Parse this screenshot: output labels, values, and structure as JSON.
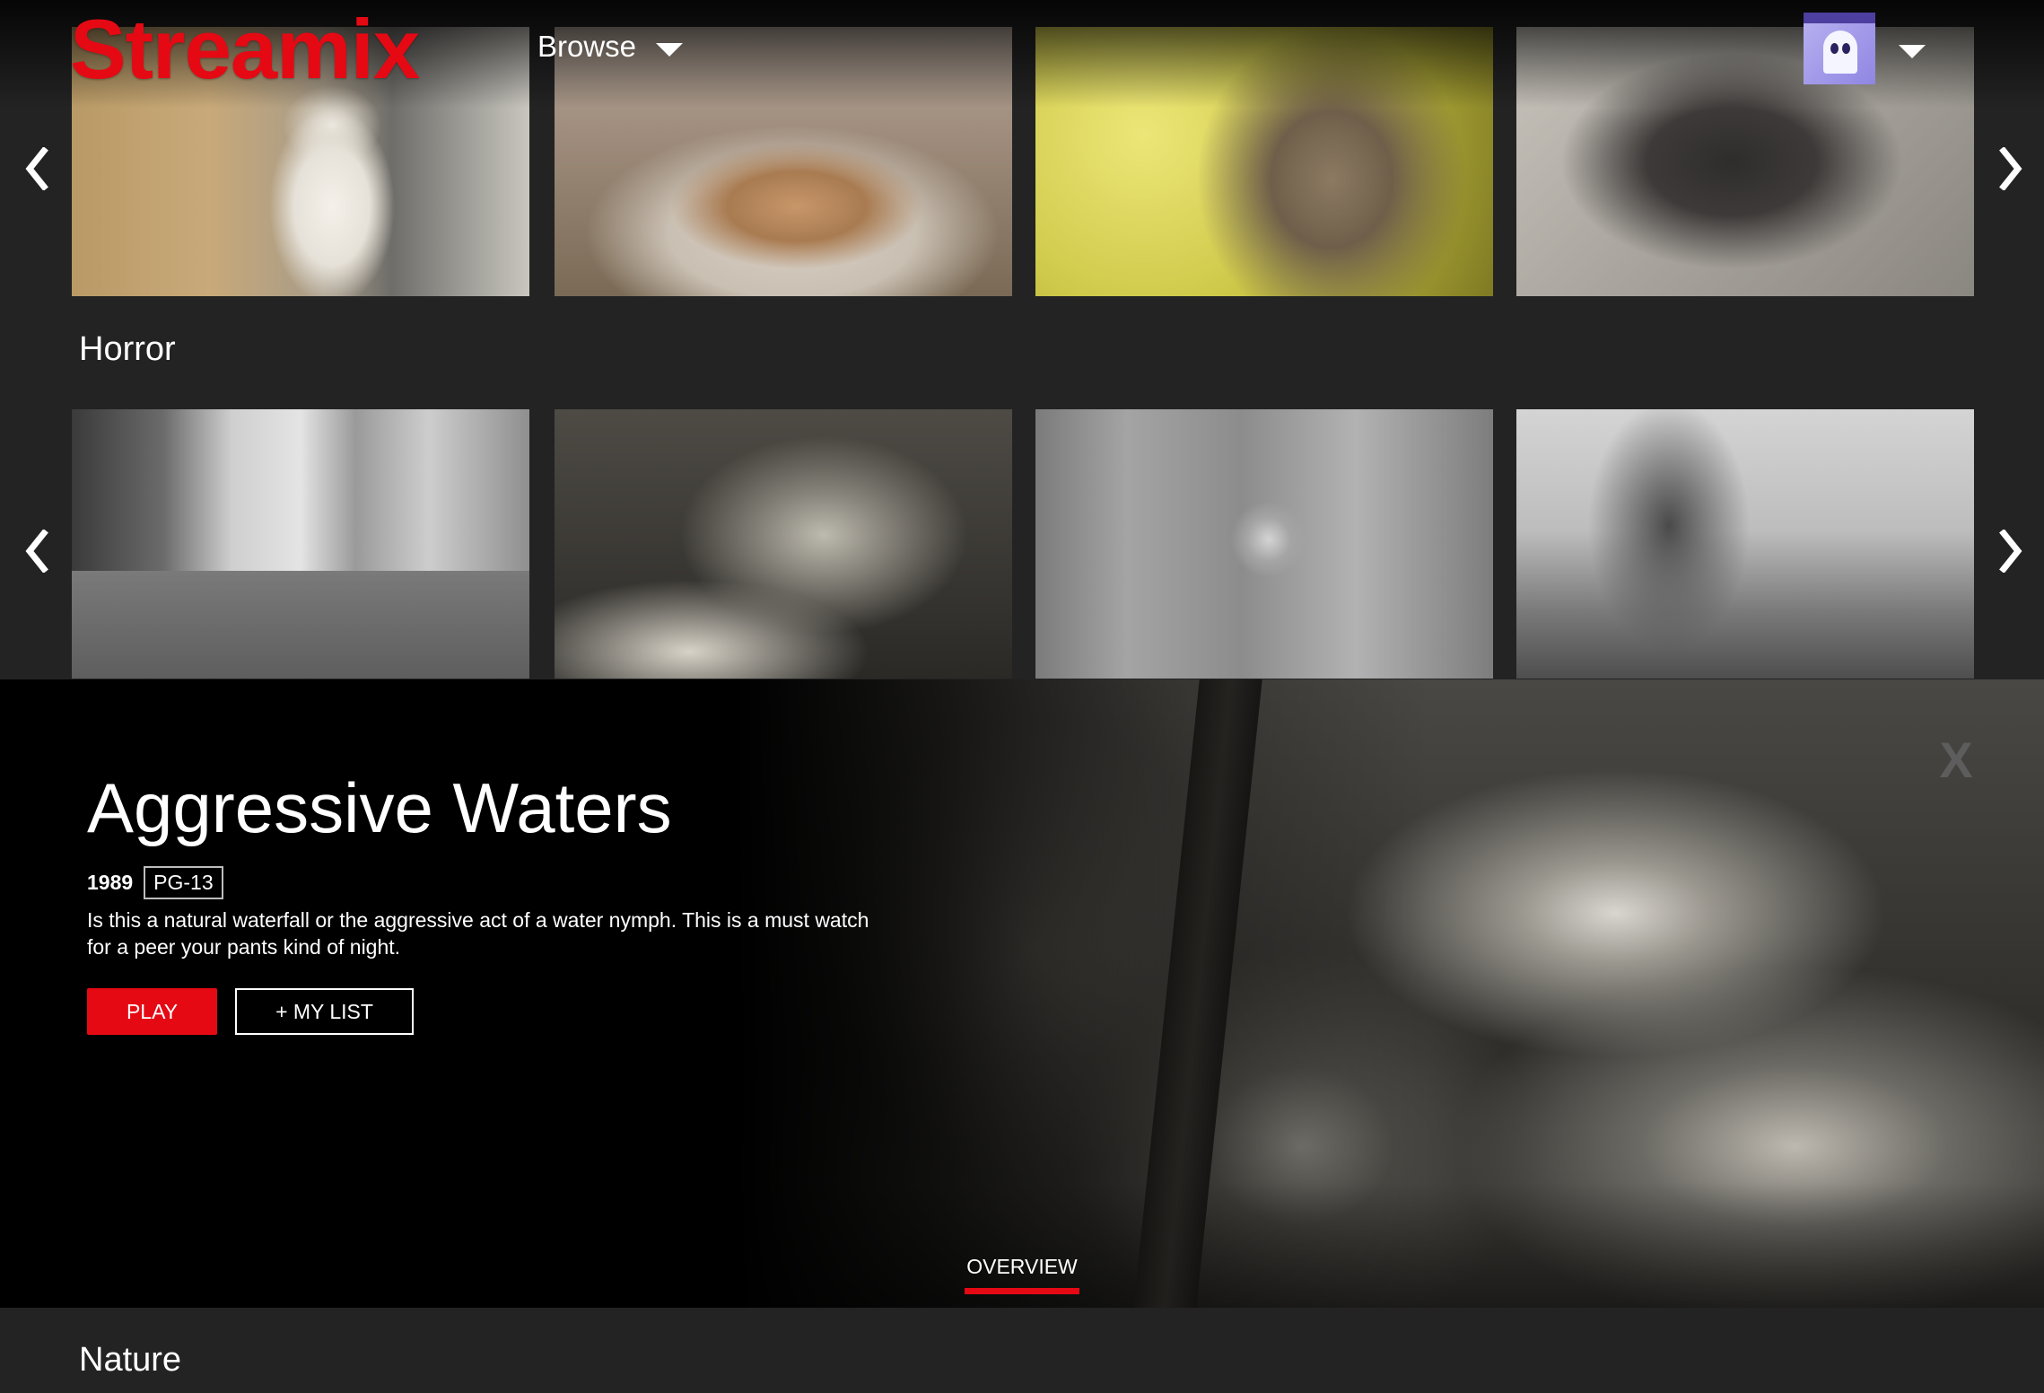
{
  "header": {
    "logo": "Streamix",
    "browse_label": "Browse",
    "avatar_icon": "ghost-avatar-icon"
  },
  "rows": [
    {
      "title": "",
      "tiles": [
        "cat-sitting-kitchen",
        "cat-on-wicker-chair",
        "grumpy-tabby-cat",
        "black-kitten-blanket"
      ]
    },
    {
      "title": "Horror",
      "tiles": [
        "city-street-bw",
        "forest-waterfall-bw",
        "snowy-forest-bw",
        "man-with-guitar-office-bw"
      ]
    },
    {
      "title": "Nature",
      "tiles": []
    }
  ],
  "feature": {
    "title": "Aggressive Waters",
    "year": "1989",
    "rating": "PG-13",
    "description": "Is this a natural waterfall or the aggressive act of a water nymph. This is a must watch for a peer your pants kind of night.",
    "play_label": "PLAY",
    "mylist_label": "+ MY LIST",
    "close_label": "X",
    "tab_label": "OVERVIEW"
  },
  "colors": {
    "brand": "#e50914",
    "background": "#232323",
    "feature_bg": "#000000"
  }
}
